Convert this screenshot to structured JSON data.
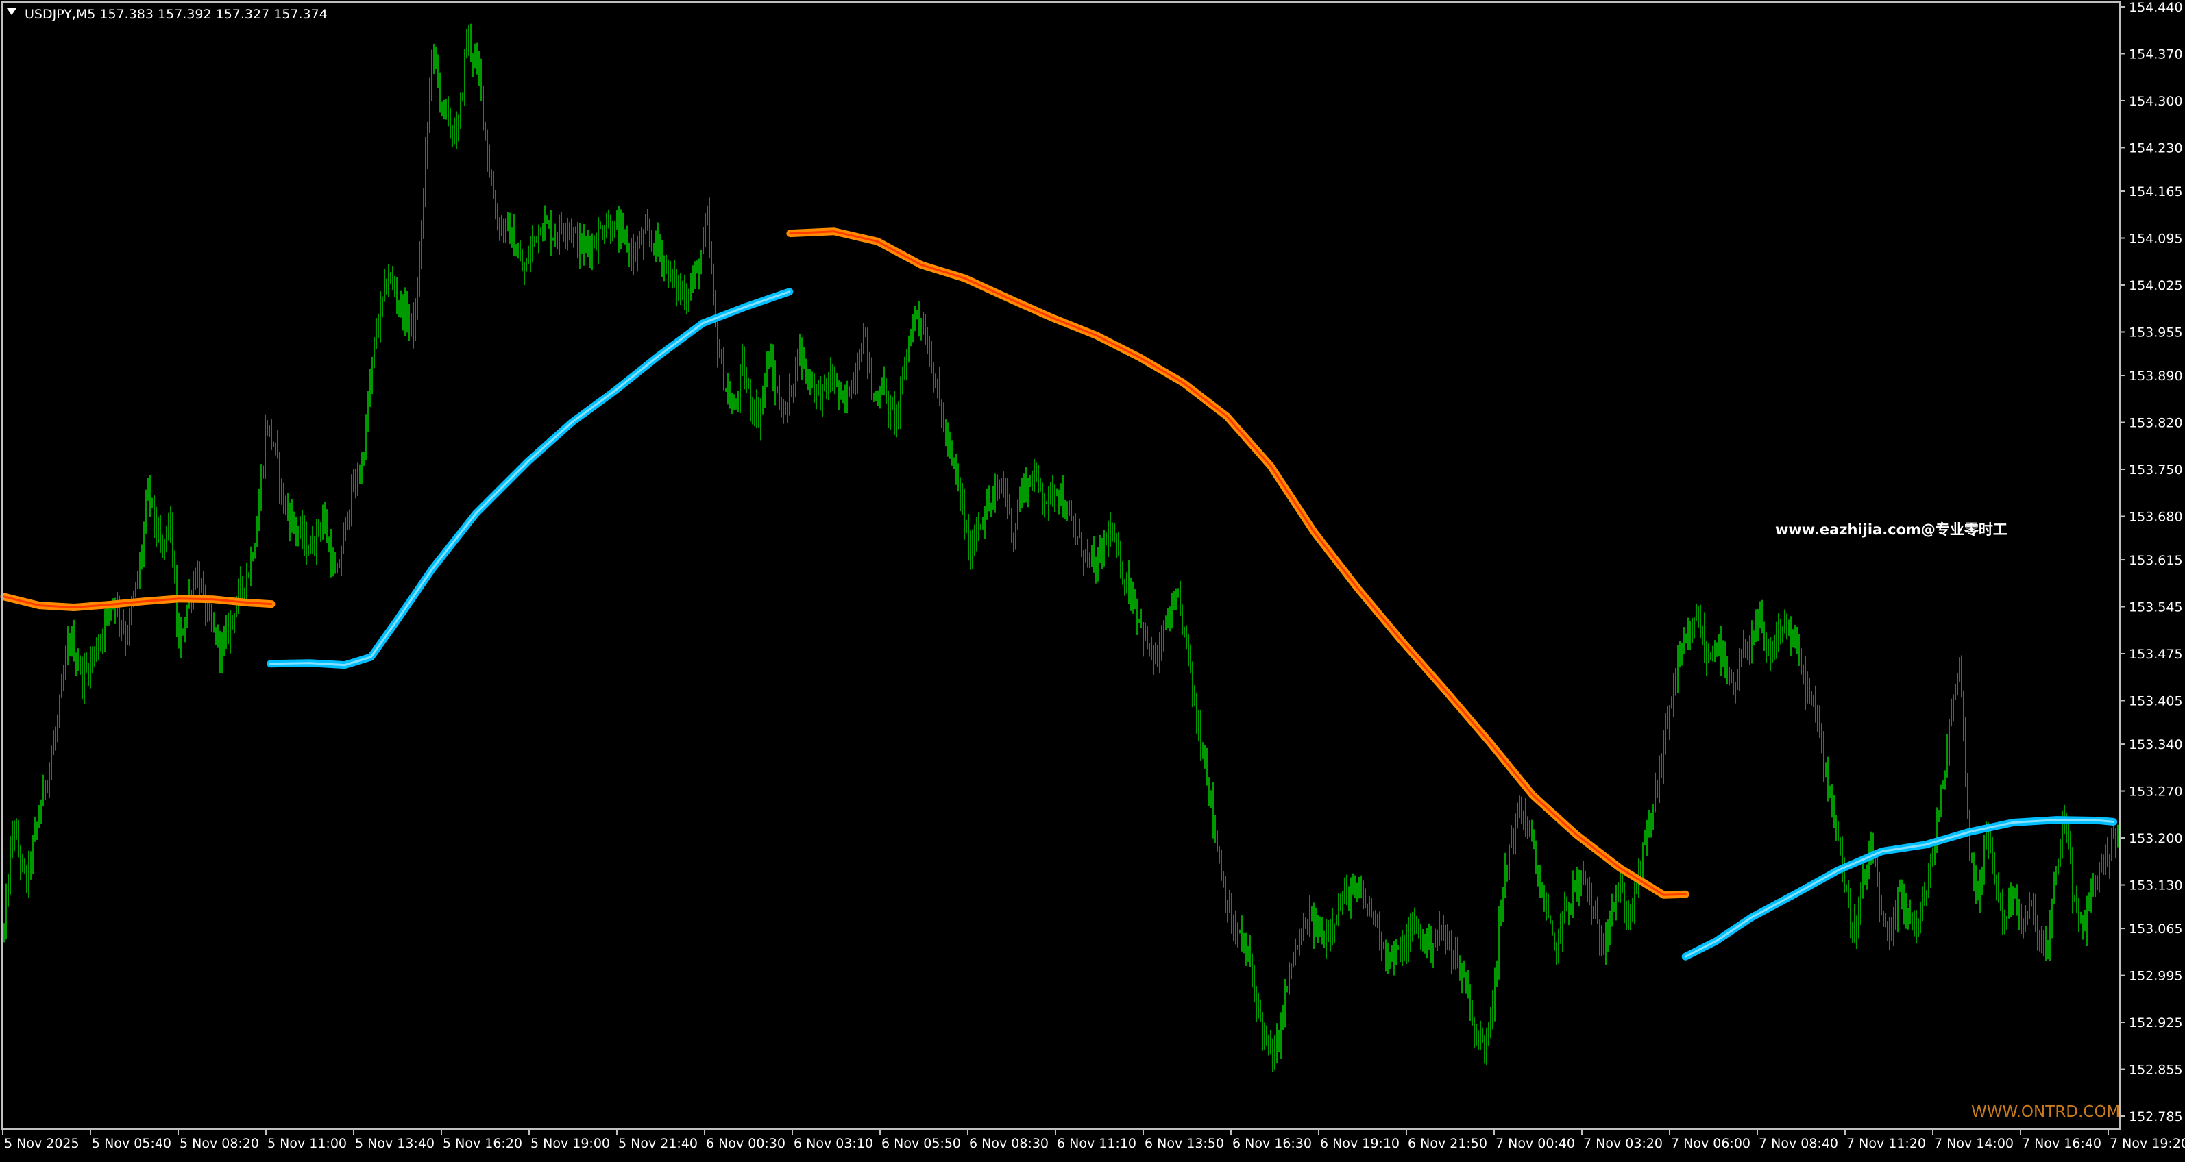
{
  "header": {
    "symbol_line": "USDJPY,M5  157.383 157.392 157.327 157.374",
    "collapse_icon": "triangle-down-icon"
  },
  "watermark": {
    "center_text": "www.eazhijia.com@专业零时工",
    "corner_text": "WWW.ONTRD.COM"
  },
  "colors": {
    "background": "#000000",
    "frame": "#c0c0c0",
    "bars": "#00c000",
    "ma_down": "#ff8c00",
    "ma_down_core": "#ff3b00",
    "ma_up": "#00bfff",
    "ma_up_core": "#87e0ff",
    "watermark_corner": "#c87a1e",
    "text": "#ffffff"
  },
  "chart_data": {
    "type": "line",
    "ylim": [
      152.77,
      154.45
    ],
    "y_ticks": [
      "154.440",
      "154.370",
      "154.300",
      "154.230",
      "154.165",
      "154.095",
      "154.025",
      "153.955",
      "153.890",
      "153.820",
      "153.750",
      "153.680",
      "153.615",
      "153.545",
      "153.475",
      "153.405",
      "153.340",
      "153.270",
      "153.200",
      "153.130",
      "153.065",
      "152.995",
      "152.925",
      "152.855",
      "152.785"
    ],
    "x_ticks": [
      "5 Nov 2025",
      "5 Nov 05:40",
      "5 Nov 08:20",
      "5 Nov 11:00",
      "5 Nov 13:40",
      "5 Nov 16:20",
      "5 Nov 19:00",
      "5 Nov 21:40",
      "6 Nov 00:30",
      "6 Nov 03:10",
      "6 Nov 05:50",
      "6 Nov 08:30",
      "6 Nov 11:10",
      "6 Nov 13:50",
      "6 Nov 16:30",
      "6 Nov 19:10",
      "6 Nov 21:50",
      "7 Nov 00:40",
      "7 Nov 03:20",
      "7 Nov 06:00",
      "7 Nov 08:40",
      "7 Nov 11:20",
      "7 Nov 14:00",
      "7 Nov 16:40",
      "7 Nov 19:20"
    ],
    "x_range": [
      0,
      24.2
    ],
    "price_path": [
      [
        0.0,
        153.06
      ],
      [
        0.1,
        153.22
      ],
      [
        0.25,
        153.13
      ],
      [
        0.45,
        153.27
      ],
      [
        0.6,
        153.36
      ],
      [
        0.75,
        153.5
      ],
      [
        0.9,
        153.44
      ],
      [
        1.05,
        153.48
      ],
      [
        1.25,
        153.56
      ],
      [
        1.4,
        153.5
      ],
      [
        1.55,
        153.6
      ],
      [
        1.65,
        153.72
      ],
      [
        1.8,
        153.62
      ],
      [
        1.9,
        153.68
      ],
      [
        2.0,
        153.48
      ],
      [
        2.1,
        153.55
      ],
      [
        2.2,
        153.6
      ],
      [
        2.35,
        153.52
      ],
      [
        2.5,
        153.48
      ],
      [
        2.65,
        153.55
      ],
      [
        2.8,
        153.6
      ],
      [
        2.9,
        153.67
      ],
      [
        3.0,
        153.82
      ],
      [
        3.1,
        153.78
      ],
      [
        3.2,
        153.7
      ],
      [
        3.35,
        153.66
      ],
      [
        3.5,
        153.63
      ],
      [
        3.65,
        153.68
      ],
      [
        3.8,
        153.58
      ],
      [
        3.95,
        153.7
      ],
      [
        4.1,
        153.76
      ],
      [
        4.25,
        153.95
      ],
      [
        4.4,
        154.04
      ],
      [
        4.55,
        153.99
      ],
      [
        4.7,
        153.96
      ],
      [
        4.8,
        154.15
      ],
      [
        4.9,
        154.38
      ],
      [
        5.0,
        154.3
      ],
      [
        5.1,
        154.26
      ],
      [
        5.2,
        154.25
      ],
      [
        5.3,
        154.4
      ],
      [
        5.45,
        154.33
      ],
      [
        5.55,
        154.2
      ],
      [
        5.65,
        154.12
      ],
      [
        5.8,
        154.1
      ],
      [
        5.95,
        154.04
      ],
      [
        6.05,
        154.09
      ],
      [
        6.15,
        154.12
      ],
      [
        6.3,
        154.1
      ],
      [
        6.45,
        154.12
      ],
      [
        6.6,
        154.08
      ],
      [
        6.75,
        154.09
      ],
      [
        6.9,
        154.12
      ],
      [
        7.05,
        154.1
      ],
      [
        7.2,
        154.07
      ],
      [
        7.35,
        154.1
      ],
      [
        7.5,
        154.08
      ],
      [
        7.65,
        154.03
      ],
      [
        7.8,
        154.01
      ],
      [
        7.95,
        154.05
      ],
      [
        8.05,
        154.12
      ],
      [
        8.15,
        153.95
      ],
      [
        8.25,
        153.88
      ],
      [
        8.35,
        153.83
      ],
      [
        8.45,
        153.9
      ],
      [
        8.55,
        153.85
      ],
      [
        8.65,
        153.83
      ],
      [
        8.75,
        153.92
      ],
      [
        8.85,
        153.86
      ],
      [
        8.95,
        153.83
      ],
      [
        9.1,
        153.93
      ],
      [
        9.2,
        153.89
      ],
      [
        9.35,
        153.86
      ],
      [
        9.5,
        153.89
      ],
      [
        9.6,
        153.84
      ],
      [
        9.75,
        153.9
      ],
      [
        9.85,
        153.96
      ],
      [
        9.95,
        153.85
      ],
      [
        10.05,
        153.88
      ],
      [
        10.15,
        153.83
      ],
      [
        10.25,
        153.84
      ],
      [
        10.35,
        153.94
      ],
      [
        10.45,
        153.99
      ],
      [
        10.55,
        153.95
      ],
      [
        10.65,
        153.89
      ],
      [
        10.75,
        153.82
      ],
      [
        10.85,
        153.76
      ],
      [
        10.95,
        153.71
      ],
      [
        11.05,
        153.62
      ],
      [
        11.15,
        153.67
      ],
      [
        11.3,
        153.7
      ],
      [
        11.45,
        153.73
      ],
      [
        11.55,
        153.65
      ],
      [
        11.65,
        153.72
      ],
      [
        11.8,
        153.74
      ],
      [
        11.95,
        153.7
      ],
      [
        12.05,
        153.73
      ],
      [
        12.2,
        153.67
      ],
      [
        12.35,
        153.63
      ],
      [
        12.5,
        153.6
      ],
      [
        12.65,
        153.66
      ],
      [
        12.8,
        153.6
      ],
      [
        12.95,
        153.55
      ],
      [
        13.1,
        153.48
      ],
      [
        13.2,
        153.46
      ],
      [
        13.3,
        153.52
      ],
      [
        13.45,
        153.55
      ],
      [
        13.55,
        153.48
      ],
      [
        13.65,
        153.38
      ],
      [
        13.75,
        153.32
      ],
      [
        13.85,
        153.22
      ],
      [
        13.95,
        153.14
      ],
      [
        14.05,
        153.07
      ],
      [
        14.15,
        153.05
      ],
      [
        14.25,
        153.02
      ],
      [
        14.35,
        152.95
      ],
      [
        14.45,
        152.89
      ],
      [
        14.55,
        152.87
      ],
      [
        14.65,
        152.95
      ],
      [
        14.75,
        153.02
      ],
      [
        14.85,
        153.05
      ],
      [
        14.95,
        153.08
      ],
      [
        15.1,
        153.05
      ],
      [
        15.25,
        153.09
      ],
      [
        15.4,
        153.12
      ],
      [
        15.55,
        153.11
      ],
      [
        15.7,
        153.08
      ],
      [
        15.85,
        153.02
      ],
      [
        16.0,
        153.03
      ],
      [
        16.15,
        153.07
      ],
      [
        16.3,
        153.04
      ],
      [
        16.45,
        153.06
      ],
      [
        16.6,
        153.03
      ],
      [
        16.75,
        152.98
      ],
      [
        16.85,
        152.9
      ],
      [
        16.95,
        152.89
      ],
      [
        17.05,
        152.97
      ],
      [
        17.15,
        153.11
      ],
      [
        17.25,
        153.2
      ],
      [
        17.35,
        153.24
      ],
      [
        17.45,
        153.22
      ],
      [
        17.55,
        153.15
      ],
      [
        17.65,
        153.09
      ],
      [
        17.75,
        153.03
      ],
      [
        17.85,
        153.08
      ],
      [
        17.95,
        153.12
      ],
      [
        18.1,
        153.14
      ],
      [
        18.2,
        153.08
      ],
      [
        18.3,
        153.04
      ],
      [
        18.4,
        153.1
      ],
      [
        18.5,
        153.12
      ],
      [
        18.6,
        153.08
      ],
      [
        18.7,
        153.13
      ],
      [
        18.8,
        153.2
      ],
      [
        18.9,
        153.26
      ],
      [
        19.0,
        153.34
      ],
      [
        19.1,
        153.42
      ],
      [
        19.2,
        153.47
      ],
      [
        19.3,
        153.5
      ],
      [
        19.4,
        153.53
      ],
      [
        19.5,
        153.46
      ],
      [
        19.6,
        153.5
      ],
      [
        19.7,
        153.45
      ],
      [
        19.8,
        153.41
      ],
      [
        19.9,
        153.47
      ],
      [
        20.0,
        153.5
      ],
      [
        20.1,
        153.52
      ],
      [
        20.2,
        153.46
      ],
      [
        20.3,
        153.5
      ],
      [
        20.4,
        153.52
      ],
      [
        20.5,
        153.49
      ],
      [
        20.6,
        153.44
      ],
      [
        20.7,
        153.4
      ],
      [
        20.8,
        153.35
      ],
      [
        20.9,
        153.27
      ],
      [
        21.0,
        153.2
      ],
      [
        21.1,
        153.1
      ],
      [
        21.2,
        153.06
      ],
      [
        21.3,
        153.14
      ],
      [
        21.4,
        153.18
      ],
      [
        21.5,
        153.07
      ],
      [
        21.6,
        153.04
      ],
      [
        21.7,
        153.12
      ],
      [
        21.8,
        153.09
      ],
      [
        21.9,
        153.06
      ],
      [
        22.0,
        153.12
      ],
      [
        22.1,
        153.19
      ],
      [
        22.2,
        153.28
      ],
      [
        22.3,
        153.4
      ],
      [
        22.4,
        153.46
      ],
      [
        22.5,
        153.18
      ],
      [
        22.6,
        153.12
      ],
      [
        22.7,
        153.2
      ],
      [
        22.8,
        153.14
      ],
      [
        22.9,
        153.07
      ],
      [
        23.0,
        153.13
      ],
      [
        23.1,
        153.06
      ],
      [
        23.2,
        153.1
      ],
      [
        23.3,
        153.05
      ],
      [
        23.4,
        153.03
      ],
      [
        23.5,
        153.16
      ],
      [
        23.6,
        153.24
      ],
      [
        23.7,
        153.1
      ],
      [
        23.8,
        153.06
      ],
      [
        23.9,
        153.13
      ],
      [
        24.0,
        153.15
      ],
      [
        24.15,
        153.2
      ]
    ],
    "series": [
      {
        "trend": "down",
        "x": [
          0.0,
          0.4,
          0.8,
          1.2,
          1.6,
          2.0,
          2.4,
          2.8,
          3.06
        ],
        "values": [
          153.56,
          153.547,
          153.544,
          153.548,
          153.553,
          153.557,
          153.556,
          153.551,
          153.549
        ]
      },
      {
        "trend": "up",
        "x": [
          3.05,
          3.5,
          3.9,
          4.2,
          4.5,
          4.9,
          5.4,
          6.0,
          6.5,
          7.0,
          7.5,
          8.0,
          8.5,
          8.99
        ],
        "values": [
          153.46,
          153.461,
          153.458,
          153.47,
          153.525,
          153.601,
          153.684,
          153.762,
          153.82,
          153.868,
          153.92,
          153.968,
          153.993,
          154.015
        ]
      },
      {
        "trend": "down",
        "x": [
          9.0,
          9.5,
          10.0,
          10.5,
          11.0,
          11.5,
          12.0,
          12.5,
          13.0,
          13.5,
          14.0,
          14.5,
          15.0,
          15.5,
          16.0,
          16.5,
          17.0,
          17.5,
          18.0,
          18.5,
          19.0,
          19.25
        ],
        "values": [
          154.102,
          154.105,
          154.09,
          154.055,
          154.035,
          154.005,
          153.976,
          153.95,
          153.917,
          153.879,
          153.829,
          153.755,
          153.656,
          153.572,
          153.494,
          153.42,
          153.344,
          153.264,
          153.205,
          153.155,
          153.115,
          153.116
        ]
      },
      {
        "trend": "up",
        "x": [
          19.25,
          19.6,
          20.0,
          20.5,
          21.0,
          21.5,
          22.0,
          22.5,
          23.0,
          23.5,
          24.0,
          24.15
        ],
        "values": [
          153.023,
          153.046,
          153.081,
          153.116,
          153.152,
          153.18,
          153.19,
          153.209,
          153.223,
          153.227,
          153.226,
          153.224
        ]
      }
    ]
  }
}
